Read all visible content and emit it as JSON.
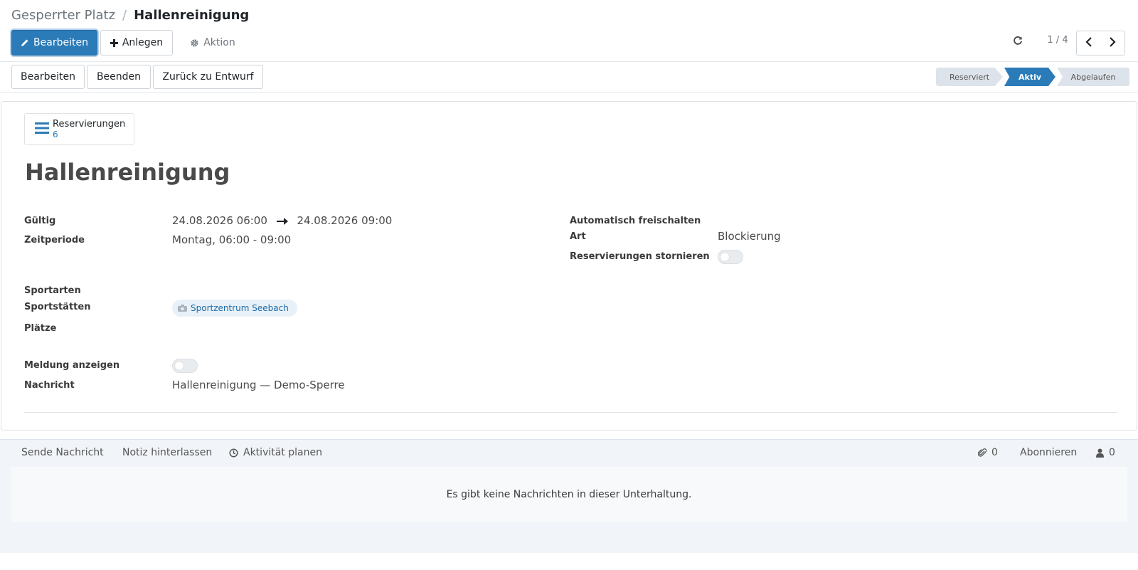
{
  "breadcrumb": {
    "parent": "Gesperrter Platz",
    "separator": "/",
    "current": "Hallenreinigung"
  },
  "toolbar": {
    "edit_label": "Bearbeiten",
    "create_label": "Anlegen",
    "action_label": "Aktion"
  },
  "pager": {
    "text": "1 / 4"
  },
  "status_buttons": {
    "edit": "Bearbeiten",
    "finish": "Beenden",
    "back_to_draft": "Zurück zu Entwurf"
  },
  "stages": [
    {
      "label": "Reserviert",
      "active": false
    },
    {
      "label": "Aktiv",
      "active": true
    },
    {
      "label": "Abgelaufen",
      "active": false
    }
  ],
  "smart_button": {
    "label": "Reservierungen",
    "count": "6"
  },
  "record": {
    "title": "Hallenreinigung",
    "fields": {
      "gueltig_label": "Gültig",
      "gueltig_start": "24.08.2026 06:00",
      "gueltig_end": "24.08.2026 09:00",
      "zeitperiode_label": "Zeitperiode",
      "zeitperiode_value": "Montag, 06:00 - 09:00",
      "auto_label": "Automatisch freischalten",
      "art_label": "Art",
      "art_value": "Blockierung",
      "storno_label": "Reservierungen stornieren",
      "sportarten_label": "Sportarten",
      "sportstaetten_label": "Sportstätten",
      "sportstaetten_tag": "Sportzentrum Seebach",
      "plaetze_label": "Plätze",
      "meldung_label": "Meldung anzeigen",
      "nachricht_label": "Nachricht",
      "nachricht_value": "Hallenreinigung — Demo-Sperre"
    },
    "toggles": {
      "storno": false,
      "meldung": false
    }
  },
  "chatter": {
    "send_message": "Sende Nachricht",
    "log_note": "Notiz hinterlassen",
    "schedule_activity": "Aktivität planen",
    "attachments_count": "0",
    "follow": "Abonnieren",
    "followers_count": "0",
    "empty_message": "Es gibt keine Nachrichten in dieser Unterhaltung."
  },
  "colors": {
    "primary": "#2b7bb9",
    "stage_inactive": "#dde3ea",
    "chatter_bg": "#f1f4f8"
  },
  "icons": [
    "pencil-icon",
    "plus-icon",
    "gear-icon",
    "refresh-icon",
    "chevron-left-icon",
    "chevron-right-icon",
    "list-icon",
    "arrow-right-icon",
    "camera-icon",
    "paperclip-icon",
    "user-icon",
    "clock-icon"
  ]
}
